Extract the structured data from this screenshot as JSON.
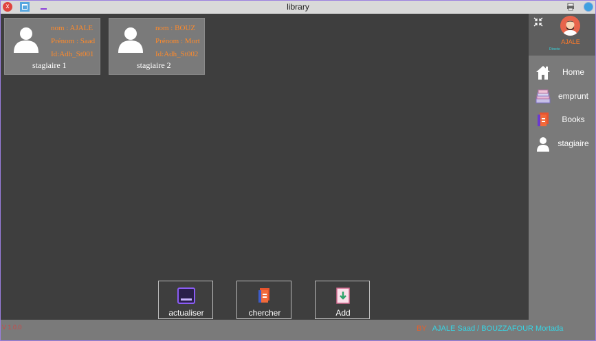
{
  "window": {
    "title": "library",
    "close_glyph": "x"
  },
  "cards": [
    {
      "nom": "nom : AJALE",
      "prenom": "Prénom : Saad",
      "id": "Id:Adh_St001",
      "label": "stagiaire 1"
    },
    {
      "nom": "nom : BOUZ",
      "prenom": "Prénom : Mort",
      "id": "Id:Adh_St002",
      "label": "stagiaire 2"
    }
  ],
  "actions": [
    {
      "label": "actualiser",
      "icon": "refresh-icon"
    },
    {
      "label": "chercher",
      "icon": "book-search-icon"
    },
    {
      "label": "Add",
      "icon": "add-book-icon"
    }
  ],
  "sidebar": {
    "user": {
      "name": "AJALE",
      "role": "Directo"
    },
    "items": [
      {
        "label": "Home",
        "icon": "home-icon"
      },
      {
        "label": "emprunt",
        "icon": "emprunt-icon"
      },
      {
        "label": "Books",
        "icon": "books-icon"
      },
      {
        "label": "stagiaire",
        "icon": "user-icon"
      }
    ]
  },
  "status": {
    "version": "V 1.0.0",
    "by": "BY",
    "authors": "AJALE  Saad / BOUZZAFOUR Mortada"
  },
  "colors": {
    "content_bg": "#3e3e3e",
    "panel_gray": "#7a7a7a",
    "accent_orange": "#ff8a2a",
    "accent_cyan": "#36d6e6",
    "frame_purple": "#9b7fe0"
  }
}
